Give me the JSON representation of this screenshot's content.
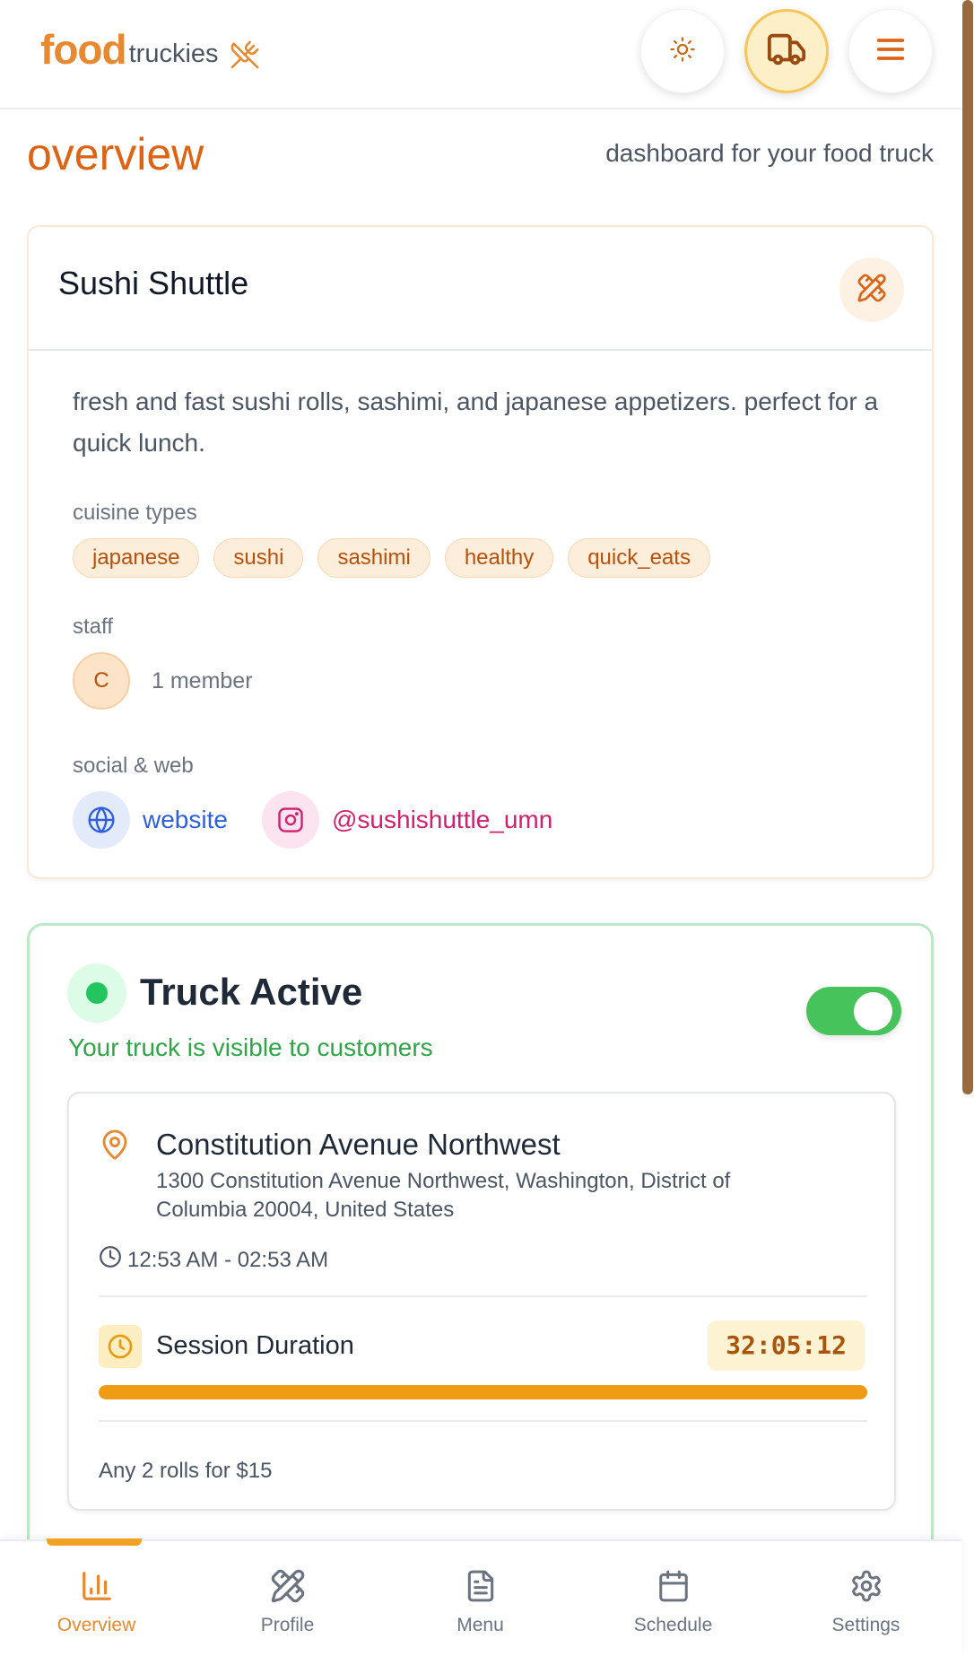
{
  "app": {
    "logo_food": "food",
    "logo_truckies": "truckies"
  },
  "header": {
    "buttons": [
      "sun-icon",
      "truck-icon",
      "menu-icon"
    ]
  },
  "page": {
    "title": "overview",
    "subtitle": "dashboard for your food truck"
  },
  "truck": {
    "name": "Sushi Shuttle",
    "description": "fresh and fast sushi rolls, sashimi, and japanese appetizers. perfect for a quick lunch.",
    "cuisine_label": "cuisine types",
    "cuisines": [
      "japanese",
      "sushi",
      "sashimi",
      "healthy",
      "quick_eats"
    ],
    "staff_label": "staff",
    "staff_initial": "C",
    "staff_count": "1 member",
    "social_label": "social & web",
    "website_label": "website",
    "instagram_handle": "@sushishuttle_umn"
  },
  "status": {
    "title": "Truck Active",
    "subtitle": "Your truck is visible to customers",
    "toggle_on": true,
    "location_name": "Constitution Avenue Northwest",
    "location_address": "1300 Constitution Avenue Northwest, Washington, District of Columbia 20004, United States",
    "time_range": "12:53 AM - 02:53 AM",
    "session_label": "Session Duration",
    "session_timer": "32:05:12",
    "session_progress": 1.0,
    "promo": "Any 2 rolls for $15"
  },
  "nav": {
    "items": [
      {
        "label": "Overview",
        "icon": "bar-chart-icon",
        "active": true
      },
      {
        "label": "Profile",
        "icon": "pencil-ruler-icon",
        "active": false
      },
      {
        "label": "Menu",
        "icon": "document-icon",
        "active": false
      },
      {
        "label": "Schedule",
        "icon": "calendar-icon",
        "active": false
      },
      {
        "label": "Settings",
        "icon": "gear-icon",
        "active": false
      }
    ]
  },
  "colors": {
    "brand": "#e8892f",
    "title": "#dd6415",
    "active_green": "#46c35a",
    "progress": "#ef9b14"
  }
}
